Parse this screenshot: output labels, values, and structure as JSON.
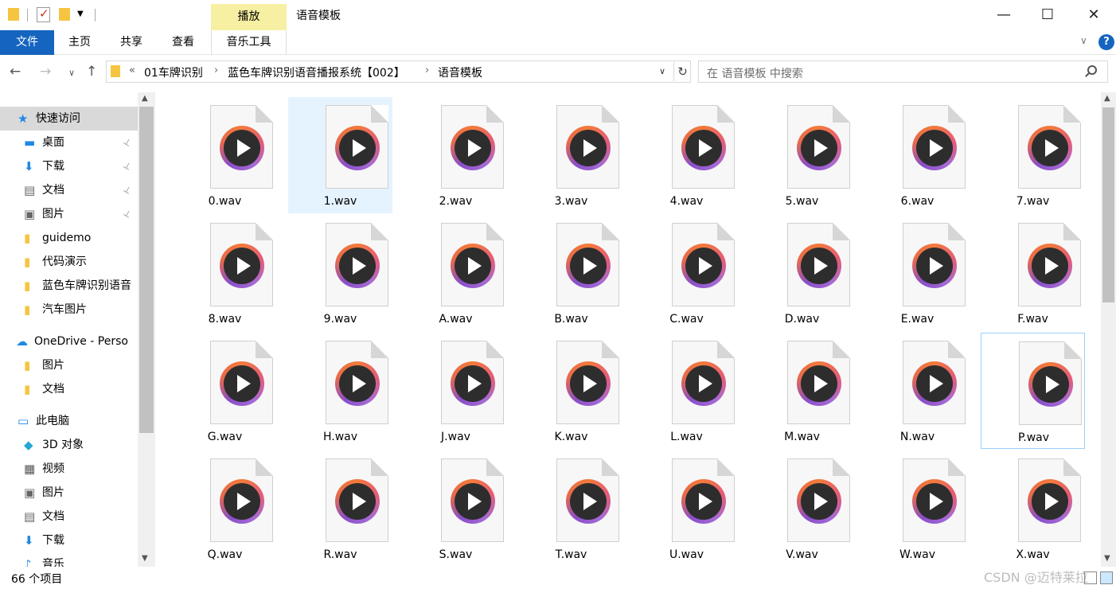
{
  "window": {
    "title": "语音模板",
    "context_tab": "播放",
    "controls": {
      "minimize": "—",
      "maximize": "☐",
      "close": "✕"
    }
  },
  "ribbon": {
    "tabs": [
      {
        "label": "文件"
      },
      {
        "label": "主页"
      },
      {
        "label": "共享"
      },
      {
        "label": "查看"
      },
      {
        "label": "音乐工具"
      }
    ],
    "help": "?"
  },
  "address": {
    "overflow": "«",
    "breadcrumbs": [
      "01车牌识别",
      "蓝色车牌识别语音播报系统【002】",
      "语音模板"
    ],
    "separator": "›",
    "search_placeholder": "在 语音模板 中搜索"
  },
  "nav": {
    "items": [
      {
        "label": "快速访问",
        "icon": "star-icon",
        "pinned": false
      },
      {
        "label": "桌面",
        "icon": "desktop-icon",
        "pinned": true
      },
      {
        "label": "下载",
        "icon": "download-icon",
        "pinned": true
      },
      {
        "label": "文档",
        "icon": "documents-icon",
        "pinned": true
      },
      {
        "label": "图片",
        "icon": "pictures-icon",
        "pinned": true
      },
      {
        "label": "guidemo",
        "icon": "folder-icon",
        "pinned": false
      },
      {
        "label": "代码演示",
        "icon": "folder-icon",
        "pinned": false
      },
      {
        "label": "蓝色车牌识别语音",
        "icon": "folder-icon",
        "pinned": false
      },
      {
        "label": "汽车图片",
        "icon": "folder-icon",
        "pinned": false
      },
      {
        "label": "OneDrive - Perso",
        "icon": "cloud-icon",
        "pinned": false
      },
      {
        "label": "图片",
        "icon": "folder-icon",
        "pinned": false
      },
      {
        "label": "文档",
        "icon": "folder-icon",
        "pinned": false
      },
      {
        "label": "此电脑",
        "icon": "computer-icon",
        "pinned": false
      },
      {
        "label": "3D 对象",
        "icon": "cube-icon",
        "pinned": false
      },
      {
        "label": "视频",
        "icon": "video-icon",
        "pinned": false
      },
      {
        "label": "图片",
        "icon": "pictures-icon",
        "pinned": false
      },
      {
        "label": "文档",
        "icon": "documents-icon",
        "pinned": false
      },
      {
        "label": "下载",
        "icon": "download-icon",
        "pinned": false
      },
      {
        "label": "音乐",
        "icon": "music-icon",
        "pinned": false
      }
    ],
    "pin_glyph": "📌"
  },
  "files": [
    {
      "name": "0.wav"
    },
    {
      "name": "1.wav",
      "state": "selected"
    },
    {
      "name": "2.wav"
    },
    {
      "name": "3.wav"
    },
    {
      "name": "4.wav"
    },
    {
      "name": "5.wav"
    },
    {
      "name": "6.wav"
    },
    {
      "name": "7.wav"
    },
    {
      "name": "8.wav"
    },
    {
      "name": "9.wav"
    },
    {
      "name": "A.wav"
    },
    {
      "name": "B.wav"
    },
    {
      "name": "C.wav"
    },
    {
      "name": "D.wav"
    },
    {
      "name": "E.wav"
    },
    {
      "name": "F.wav"
    },
    {
      "name": "G.wav"
    },
    {
      "name": "H.wav"
    },
    {
      "name": "J.wav"
    },
    {
      "name": "K.wav"
    },
    {
      "name": "L.wav"
    },
    {
      "name": "M.wav"
    },
    {
      "name": "N.wav"
    },
    {
      "name": "P.wav",
      "state": "focused"
    },
    {
      "name": "Q.wav"
    },
    {
      "name": "R.wav"
    },
    {
      "name": "S.wav"
    },
    {
      "name": "T.wav"
    },
    {
      "name": "U.wav"
    },
    {
      "name": "V.wav"
    },
    {
      "name": "W.wav"
    },
    {
      "name": "X.wav"
    }
  ],
  "status": {
    "count": "66 个项目",
    "watermark": "CSDN @迈特莱拉"
  },
  "colors": {
    "file_tab": "#1565c0",
    "context_tab": "#f7f0a2",
    "selection": "#e5f3ff",
    "play_ring": [
      "#f47a3a",
      "#a56ad6"
    ]
  }
}
